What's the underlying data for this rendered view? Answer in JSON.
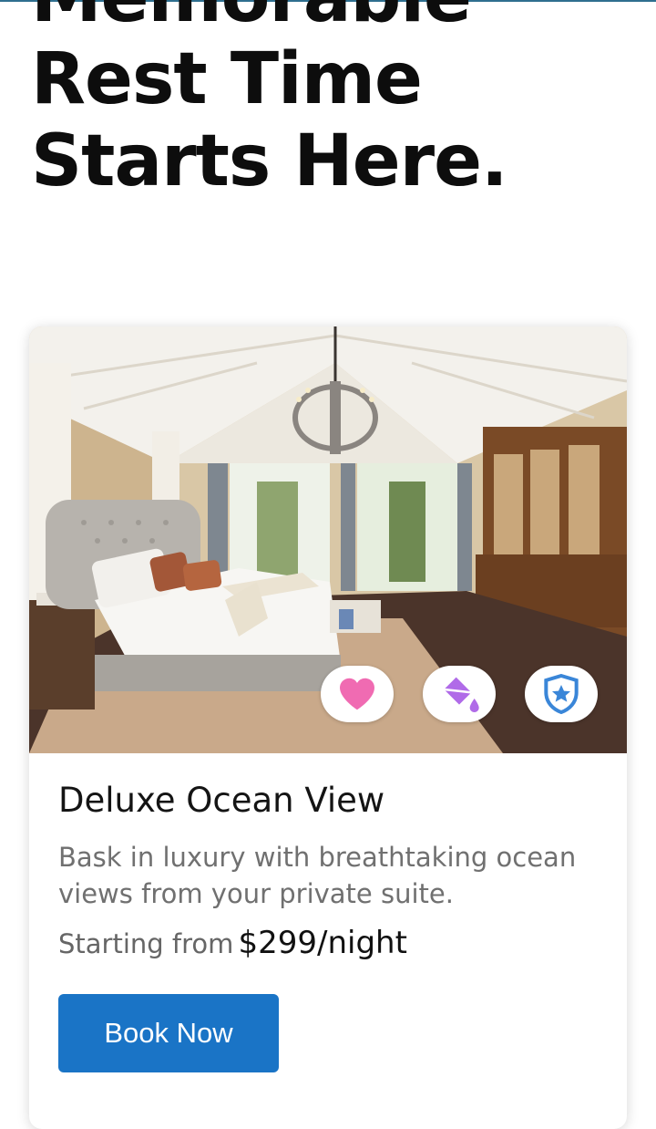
{
  "hero": {
    "title": "Memorable\nRest Time\nStarts Here."
  },
  "room": {
    "image_alt": "Luxury bedroom with vaulted ceiling and chandelier",
    "name": "Deluxe Ocean View",
    "description": "Bask in luxury with breathtaking ocean views from your private suite.",
    "price_label": "Starting from",
    "price_value": "$299/night",
    "cta_label": "Book Now",
    "features": [
      {
        "icon": "heart-icon",
        "color": "#f06bb2"
      },
      {
        "icon": "paint-bucket-icon",
        "color": "#b06be8"
      },
      {
        "icon": "shield-star-icon",
        "color": "#3a86d8"
      }
    ]
  },
  "colors": {
    "accent": "#1a74c6",
    "heading": "#0d0d0d",
    "muted": "#707070"
  }
}
